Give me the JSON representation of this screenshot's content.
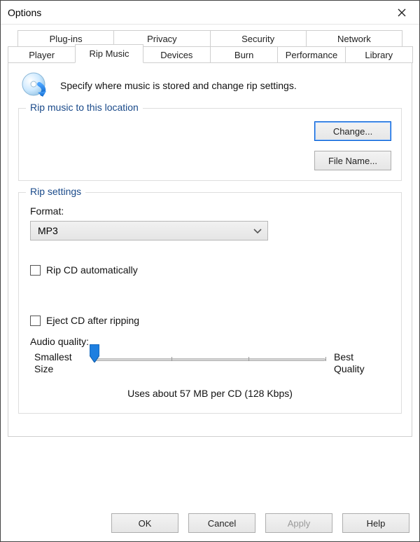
{
  "window": {
    "title": "Options"
  },
  "tabs": {
    "row1": [
      "Plug-ins",
      "Privacy",
      "Security",
      "Network"
    ],
    "row2": [
      "Player",
      "Rip Music",
      "Devices",
      "Burn",
      "Performance",
      "Library"
    ],
    "active": "Rip Music"
  },
  "panel": {
    "description": "Specify where music is stored and change rip settings."
  },
  "group_location": {
    "legend": "Rip music to this location",
    "change": "Change...",
    "filename": "File Name..."
  },
  "group_settings": {
    "legend": "Rip settings",
    "format_label": "Format:",
    "format_value": "MP3",
    "rip_auto": "Rip CD automatically",
    "eject": "Eject CD after ripping",
    "quality_label": "Audio quality:",
    "slider": {
      "left_label_1": "Smallest",
      "left_label_2": "Size",
      "right_label_1": "Best",
      "right_label_2": "Quality",
      "hint": "Uses about 57 MB per CD (128 Kbps)"
    }
  },
  "buttons": {
    "ok": "OK",
    "cancel": "Cancel",
    "apply": "Apply",
    "help": "Help"
  }
}
